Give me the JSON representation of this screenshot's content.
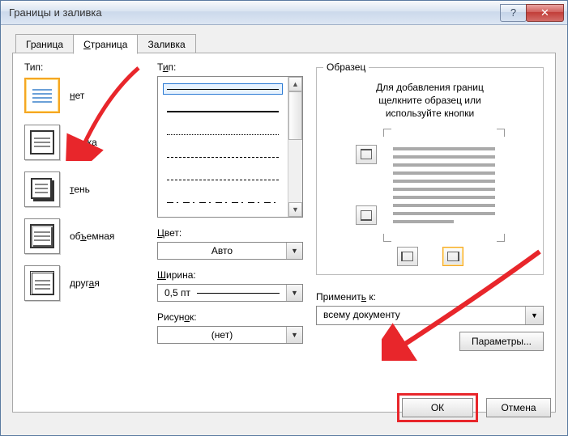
{
  "window": {
    "title": "Границы и заливка"
  },
  "tabs": [
    {
      "label": "Граница"
    },
    {
      "label": "Страница"
    },
    {
      "label": "Заливка"
    }
  ],
  "col1": {
    "heading": "Тип:",
    "items": [
      {
        "label": "нет"
      },
      {
        "label": "рамка"
      },
      {
        "label": "тень"
      },
      {
        "label": "объемная"
      },
      {
        "label": "другая"
      }
    ]
  },
  "col2": {
    "style_heading": "Тип:",
    "color_heading": "Цвет:",
    "color_value": "Авто",
    "width_heading": "Ширина:",
    "width_value": "0,5 пт",
    "art_heading": "Рисунок:",
    "art_value": "(нет)"
  },
  "preview": {
    "legend": "Образец",
    "hint_line1": "Для добавления границ",
    "hint_line2": "щелкните образец или",
    "hint_line3": "используйте кнопки"
  },
  "apply": {
    "label": "Применить к:",
    "value": "всему документу"
  },
  "buttons": {
    "params": "Параметры...",
    "ok": "ОК",
    "cancel": "Отмена"
  }
}
